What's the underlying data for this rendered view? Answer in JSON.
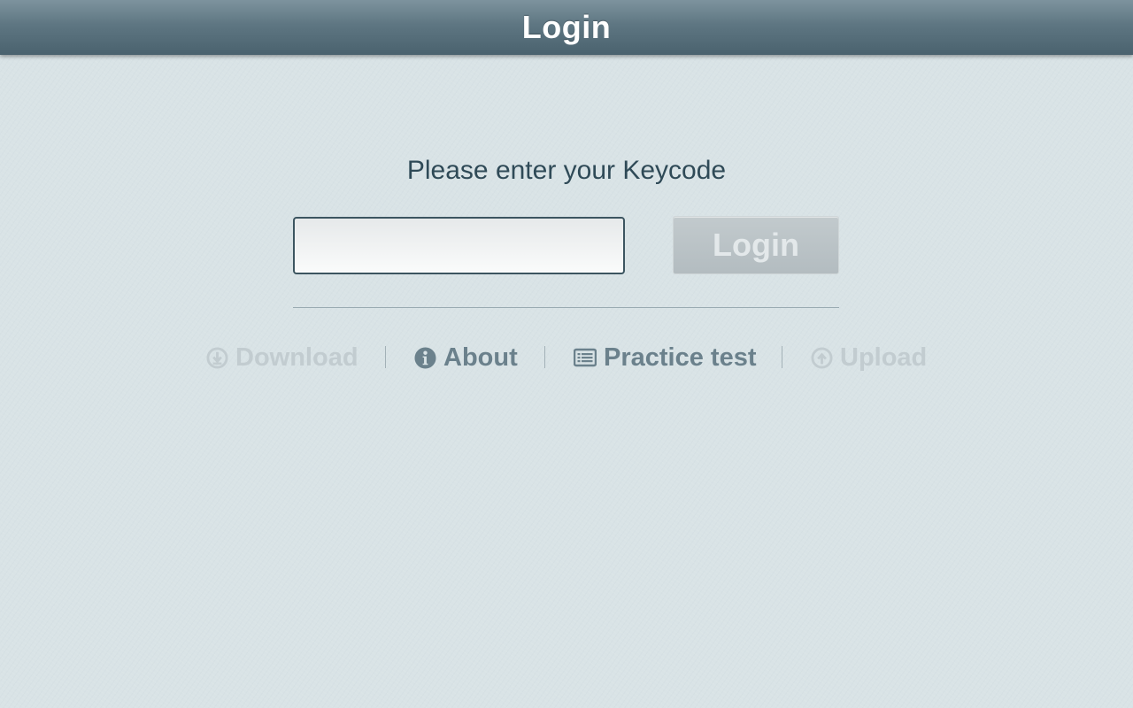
{
  "header": {
    "title": "Login"
  },
  "login_form": {
    "prompt": "Please enter your Keycode",
    "keycode_value": "",
    "keycode_placeholder": "",
    "login_label": "Login"
  },
  "nav": {
    "download": {
      "label": "Download",
      "icon": "download-circle-icon",
      "enabled": false
    },
    "about": {
      "label": "About",
      "icon": "info-circle-icon",
      "enabled": true
    },
    "practice_test": {
      "label": "Practice test",
      "icon": "list-card-icon",
      "enabled": true
    },
    "upload": {
      "label": "Upload",
      "icon": "upload-circle-icon",
      "enabled": false
    }
  },
  "colors": {
    "header_gradient_top": "#7d939e",
    "header_gradient_bottom": "#4a626e",
    "background": "#d9e3e6",
    "text_primary": "#2f4a57",
    "nav_enabled": "#6b818c",
    "nav_disabled": "#c2ccd0",
    "button_disabled_bg": "#bcc4c7"
  }
}
